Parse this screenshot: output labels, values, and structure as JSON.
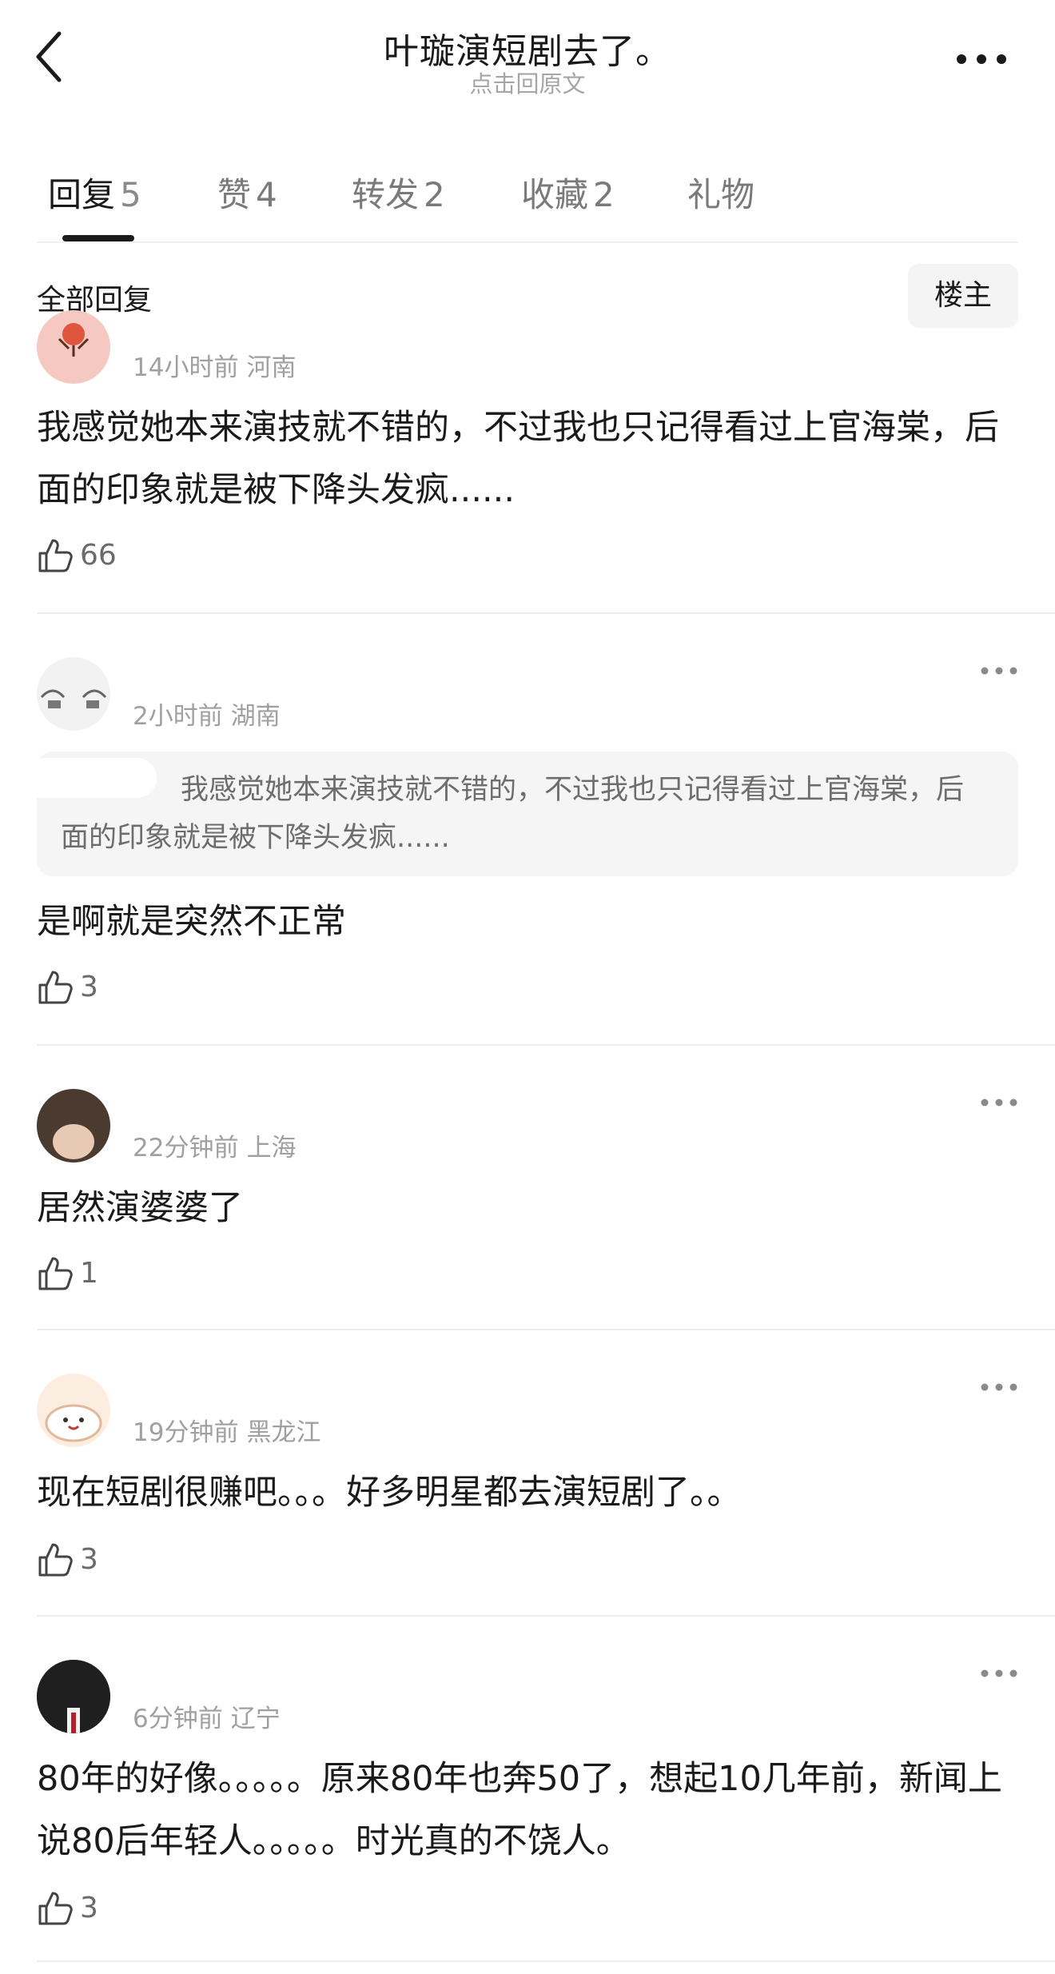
{
  "header": {
    "title": "叶璇演短剧去了。",
    "subtitle": "点击回原文"
  },
  "tabs": [
    {
      "label": "回复",
      "count": "5",
      "active": true
    },
    {
      "label": "赞",
      "count": "4"
    },
    {
      "label": "转发",
      "count": "2"
    },
    {
      "label": "收藏",
      "count": "2"
    },
    {
      "label": "礼物",
      "count": ""
    }
  ],
  "section": {
    "title": "全部回复",
    "filter_label": "楼主"
  },
  "comments": [
    {
      "time": "14小时前",
      "region": "河南",
      "text": "我感觉她本来演技就不错的，不过我也只记得看过上官海棠，后面的印象就是被下降头发疯......",
      "likes": "66"
    },
    {
      "time": "2小时前",
      "region": "湖南",
      "quote": "我感觉她本来演技就不错的，不过我也只记得看过上官海棠，后面的印象就是被下降头发疯......",
      "text": "是啊就是突然不正常",
      "likes": "3"
    },
    {
      "time": "22分钟前",
      "region": "上海",
      "text": "居然演婆婆了",
      "likes": "1"
    },
    {
      "time": "19分钟前",
      "region": "黑龙江",
      "text": "现在短剧很赚吧。。。好多明星都去演短剧了。。",
      "likes": "3"
    },
    {
      "time": "6分钟前",
      "region": "辽宁",
      "text": "80年的好像。。。。。原来80年也奔50了，想起10几年前，新闻上说80后年轻人。。。。。时光真的不饶人。",
      "likes": "3"
    }
  ],
  "icons": {
    "back": "chevron-left-icon",
    "more": "more-horizontal-icon",
    "like": "thumbs-up-icon"
  },
  "colors": {
    "text_primary": "#1a1a1a",
    "text_secondary": "#a0a0a0",
    "divider": "#ededed",
    "quote_bg": "#f5f5f5"
  }
}
